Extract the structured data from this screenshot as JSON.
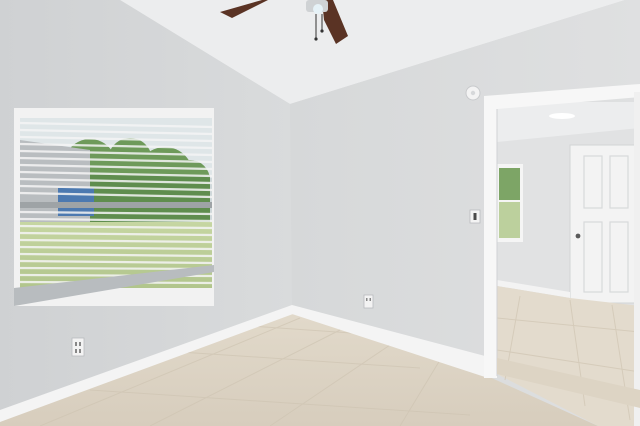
{
  "scene": {
    "subject": "empty-room-interior",
    "colors": {
      "left_wall": "#d3d5d7",
      "right_wall": "#dcdddf",
      "ceiling": "#eceded",
      "floor": "#dcd3c4",
      "baseboard": "#f3f3f3",
      "trim": "#f7f7f7",
      "fan_blade": "#5a3324",
      "next_room_wall": "#e1e2e3",
      "next_room_floor": "#e3dbcd",
      "grass": "#b9cc95",
      "trees": "#6e9a5a"
    },
    "icons": {
      "fan": "ceiling-fan-icon",
      "smoke_detector": "smoke-detector-icon",
      "light_switch": "light-switch-icon",
      "outlets": "power-outlet-icon",
      "door_knob": "door-knob-icon"
    }
  }
}
